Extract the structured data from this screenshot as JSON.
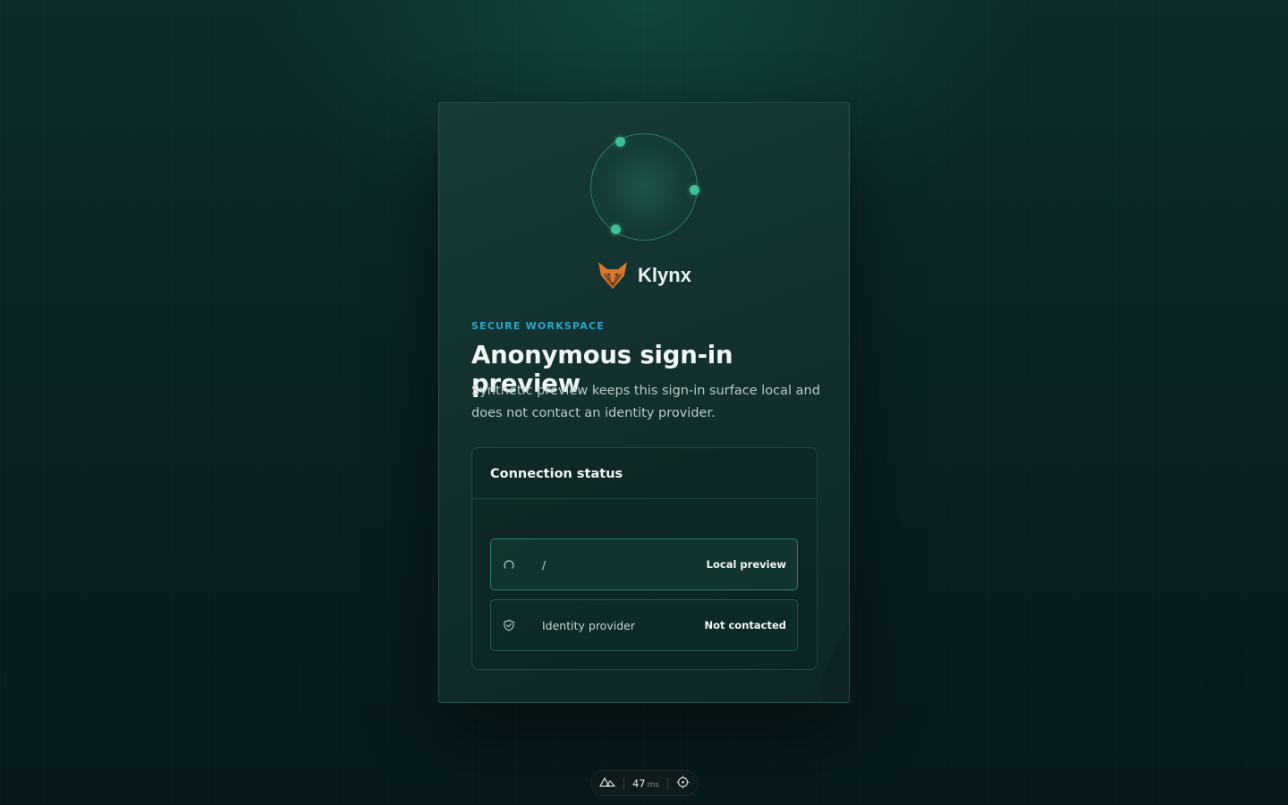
{
  "brand": {
    "name": "Klynx",
    "logo_icon": "fox-head-icon"
  },
  "hero": {
    "eyebrow": "SECURE WORKSPACE",
    "title": "Anonymous sign-in preview",
    "description": "Synthetic preview keeps this sign-in surface local and does not contact an identity provider."
  },
  "status": {
    "title": "Connection status",
    "rows": [
      {
        "icon": "spinner-icon",
        "label": "/",
        "value": "Local preview"
      },
      {
        "icon": "shield-check-icon",
        "label": "Identity provider",
        "value": "Not contacted"
      }
    ]
  },
  "devbar": {
    "logo_icon": "nuxt-logo-icon",
    "latency_value": "47",
    "latency_unit": "ms",
    "inspect_icon": "crosshair-icon"
  },
  "colors": {
    "accent": "#3fbf95",
    "eyebrow": "#2fa6c7",
    "brand_orange": "#e0782a"
  }
}
